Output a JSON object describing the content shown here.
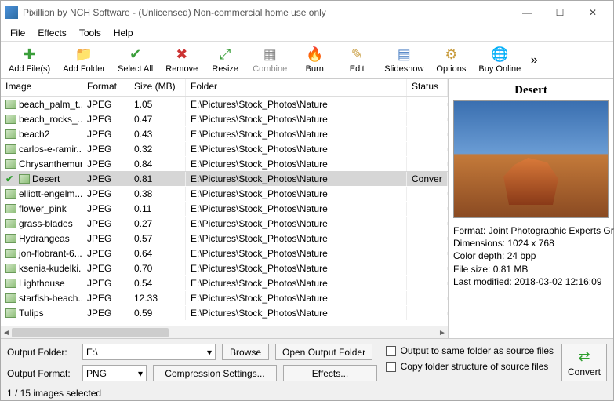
{
  "titlebar": {
    "text": "Pixillion by NCH Software - (Unlicensed) Non-commercial home use only"
  },
  "menu": {
    "file": "File",
    "effects": "Effects",
    "tools": "Tools",
    "help": "Help"
  },
  "toolbar": {
    "add_files": "Add File(s)",
    "add_folder": "Add Folder",
    "select_all": "Select All",
    "remove": "Remove",
    "resize": "Resize",
    "combine": "Combine",
    "burn": "Burn",
    "edit": "Edit",
    "slideshow": "Slideshow",
    "options": "Options",
    "buy_online": "Buy Online"
  },
  "columns": {
    "image": "Image",
    "format": "Format",
    "size": "Size (MB)",
    "folder": "Folder",
    "status": "Status"
  },
  "rows": [
    {
      "name": "beach_palm_t...",
      "format": "JPEG",
      "size": "1.05",
      "folder": "E:\\Pictures\\Stock_Photos\\Nature",
      "status": "",
      "selected": false
    },
    {
      "name": "beach_rocks_...",
      "format": "JPEG",
      "size": "0.47",
      "folder": "E:\\Pictures\\Stock_Photos\\Nature",
      "status": "",
      "selected": false
    },
    {
      "name": "beach2",
      "format": "JPEG",
      "size": "0.43",
      "folder": "E:\\Pictures\\Stock_Photos\\Nature",
      "status": "",
      "selected": false
    },
    {
      "name": "carlos-e-ramir...",
      "format": "JPEG",
      "size": "0.32",
      "folder": "E:\\Pictures\\Stock_Photos\\Nature",
      "status": "",
      "selected": false
    },
    {
      "name": "Chrysanthemum",
      "format": "JPEG",
      "size": "0.84",
      "folder": "E:\\Pictures\\Stock_Photos\\Nature",
      "status": "",
      "selected": false
    },
    {
      "name": "Desert",
      "format": "JPEG",
      "size": "0.81",
      "folder": "E:\\Pictures\\Stock_Photos\\Nature",
      "status": "Conver",
      "selected": true
    },
    {
      "name": "elliott-engelm...",
      "format": "JPEG",
      "size": "0.38",
      "folder": "E:\\Pictures\\Stock_Photos\\Nature",
      "status": "",
      "selected": false
    },
    {
      "name": "flower_pink",
      "format": "JPEG",
      "size": "0.11",
      "folder": "E:\\Pictures\\Stock_Photos\\Nature",
      "status": "",
      "selected": false
    },
    {
      "name": "grass-blades",
      "format": "JPEG",
      "size": "0.27",
      "folder": "E:\\Pictures\\Stock_Photos\\Nature",
      "status": "",
      "selected": false
    },
    {
      "name": "Hydrangeas",
      "format": "JPEG",
      "size": "0.57",
      "folder": "E:\\Pictures\\Stock_Photos\\Nature",
      "status": "",
      "selected": false
    },
    {
      "name": "jon-flobrant-6...",
      "format": "JPEG",
      "size": "0.64",
      "folder": "E:\\Pictures\\Stock_Photos\\Nature",
      "status": "",
      "selected": false
    },
    {
      "name": "ksenia-kudelki...",
      "format": "JPEG",
      "size": "0.70",
      "folder": "E:\\Pictures\\Stock_Photos\\Nature",
      "status": "",
      "selected": false
    },
    {
      "name": "Lighthouse",
      "format": "JPEG",
      "size": "0.54",
      "folder": "E:\\Pictures\\Stock_Photos\\Nature",
      "status": "",
      "selected": false
    },
    {
      "name": "starfish-beach...",
      "format": "JPEG",
      "size": "12.33",
      "folder": "E:\\Pictures\\Stock_Photos\\Nature",
      "status": "",
      "selected": false
    },
    {
      "name": "Tulips",
      "format": "JPEG",
      "size": "0.59",
      "folder": "E:\\Pictures\\Stock_Photos\\Nature",
      "status": "",
      "selected": false
    }
  ],
  "preview": {
    "title": "Desert",
    "format_label": "Format:",
    "format_value": "Joint Photographic Experts Group",
    "dimensions_label": "Dimensions:",
    "dimensions_value": "1024 x 768",
    "depth_label": "Color depth:",
    "depth_value": "24 bpp",
    "filesize_label": "File size:",
    "filesize_value": "0.81 MB",
    "modified_label": "Last modified:",
    "modified_value": "2018-03-02 12:16:09"
  },
  "output": {
    "folder_label": "Output Folder:",
    "folder_value": "E:\\",
    "browse": "Browse",
    "open_output": "Open Output Folder",
    "format_label": "Output Format:",
    "format_value": "PNG",
    "compression": "Compression Settings...",
    "effects": "Effects...",
    "same_folder": "Output to same folder as source files",
    "copy_structure": "Copy folder structure of source files",
    "convert": "Convert"
  },
  "statusbar": {
    "text": "1 / 15 images selected"
  }
}
